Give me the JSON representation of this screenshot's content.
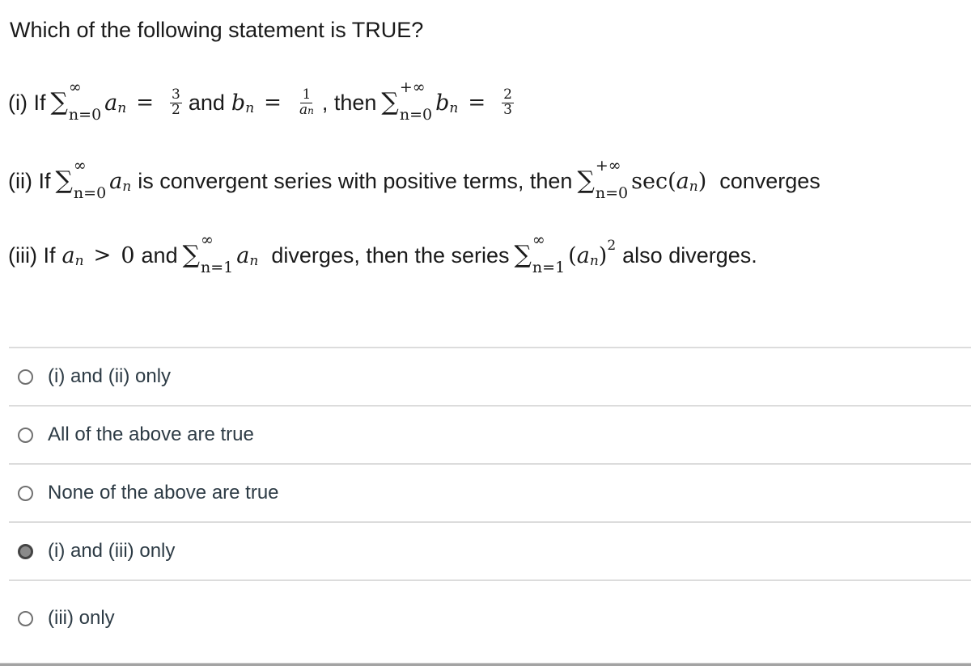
{
  "question": {
    "title": "Which of the following statement is TRUE?"
  },
  "statements": [
    {
      "label": "(i) If",
      "parts": {
        "sum1_upper": "∞",
        "sum1_lower": "n=0",
        "term1": "a",
        "term1_sub": "n",
        "eq": "=",
        "frac1_num": "3",
        "frac1_den": "2",
        "and": "and",
        "term2": "b",
        "term2_sub": "n",
        "eq2": "=",
        "frac2_num": "1",
        "frac2_den": "a",
        "frac2_den_sub": "n",
        "comma_then": ", then",
        "sum2_upper": "+∞",
        "sum2_lower": "n=0",
        "term3": "b",
        "term3_sub": "n",
        "eq3": "=",
        "frac3_num": "2",
        "frac3_den": "3"
      }
    },
    {
      "label": "(ii) If",
      "parts": {
        "sum1_upper": "∞",
        "sum1_lower": "n=0",
        "term1": "a",
        "term1_sub": "n",
        "mid": "is convergent series with positive terms, then",
        "sum2_upper": "+∞",
        "sum2_lower": "n=0",
        "func": "sec(",
        "term2": "a",
        "term2_sub": "n",
        "close": ")",
        "end": "converges"
      }
    },
    {
      "label": "(iii) If",
      "parts": {
        "term1": "a",
        "term1_sub": "n",
        "gt": ">",
        "zero": "0",
        "and": "and",
        "sum1_upper": "∞",
        "sum1_lower": "n=1",
        "term2": "a",
        "term2_sub": "n",
        "mid": "diverges, then the series",
        "sum2_upper": "∞",
        "sum2_lower": "n=1",
        "open": "(",
        "term3": "a",
        "term3_sub": "n",
        "close": ")",
        "power": "2",
        "end": "also diverges."
      }
    }
  ],
  "sigma": "∑",
  "options": [
    {
      "label": "(i) and (ii) only",
      "selected": false
    },
    {
      "label": "All of the above are true",
      "selected": false
    },
    {
      "label": "None of the above are true",
      "selected": false
    },
    {
      "label": "(i) and (iii) only",
      "selected": true
    },
    {
      "label": "(iii) only",
      "selected": false
    }
  ]
}
